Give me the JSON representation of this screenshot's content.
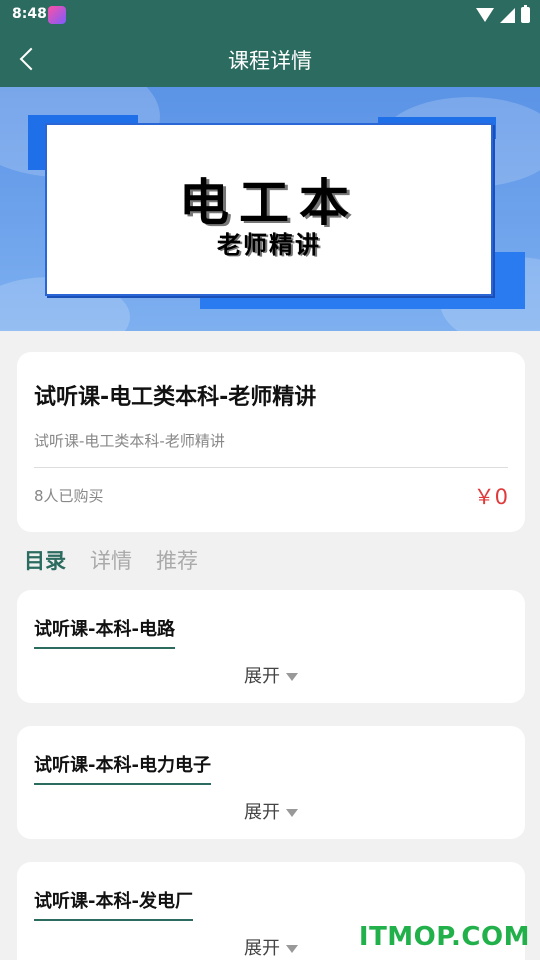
{
  "status_bar": {
    "time": "8:48"
  },
  "app_bar": {
    "title": "课程详情"
  },
  "banner": {
    "main_text": "电工本",
    "sub_text": "老师精讲"
  },
  "course": {
    "title": "试听课-电工类本科-老师精讲",
    "subtitle": "试听课-电工类本科-老师精讲",
    "buyers": "8人已购买",
    "price": "￥0"
  },
  "tabs": [
    {
      "label": "目录",
      "active": true
    },
    {
      "label": "详情",
      "active": false
    },
    {
      "label": "推荐",
      "active": false
    }
  ],
  "chapters": [
    {
      "title": "试听课-本科-电路",
      "expand_label": "展开"
    },
    {
      "title": "试听课-本科-电力电子",
      "expand_label": "展开"
    },
    {
      "title": "试听课-本科-发电厂",
      "expand_label": "展开"
    }
  ],
  "watermark": "ITMOP.COM",
  "colors": {
    "primary": "#2c6b5f",
    "price": "#e03a3a",
    "banner": "#5b93e6"
  }
}
